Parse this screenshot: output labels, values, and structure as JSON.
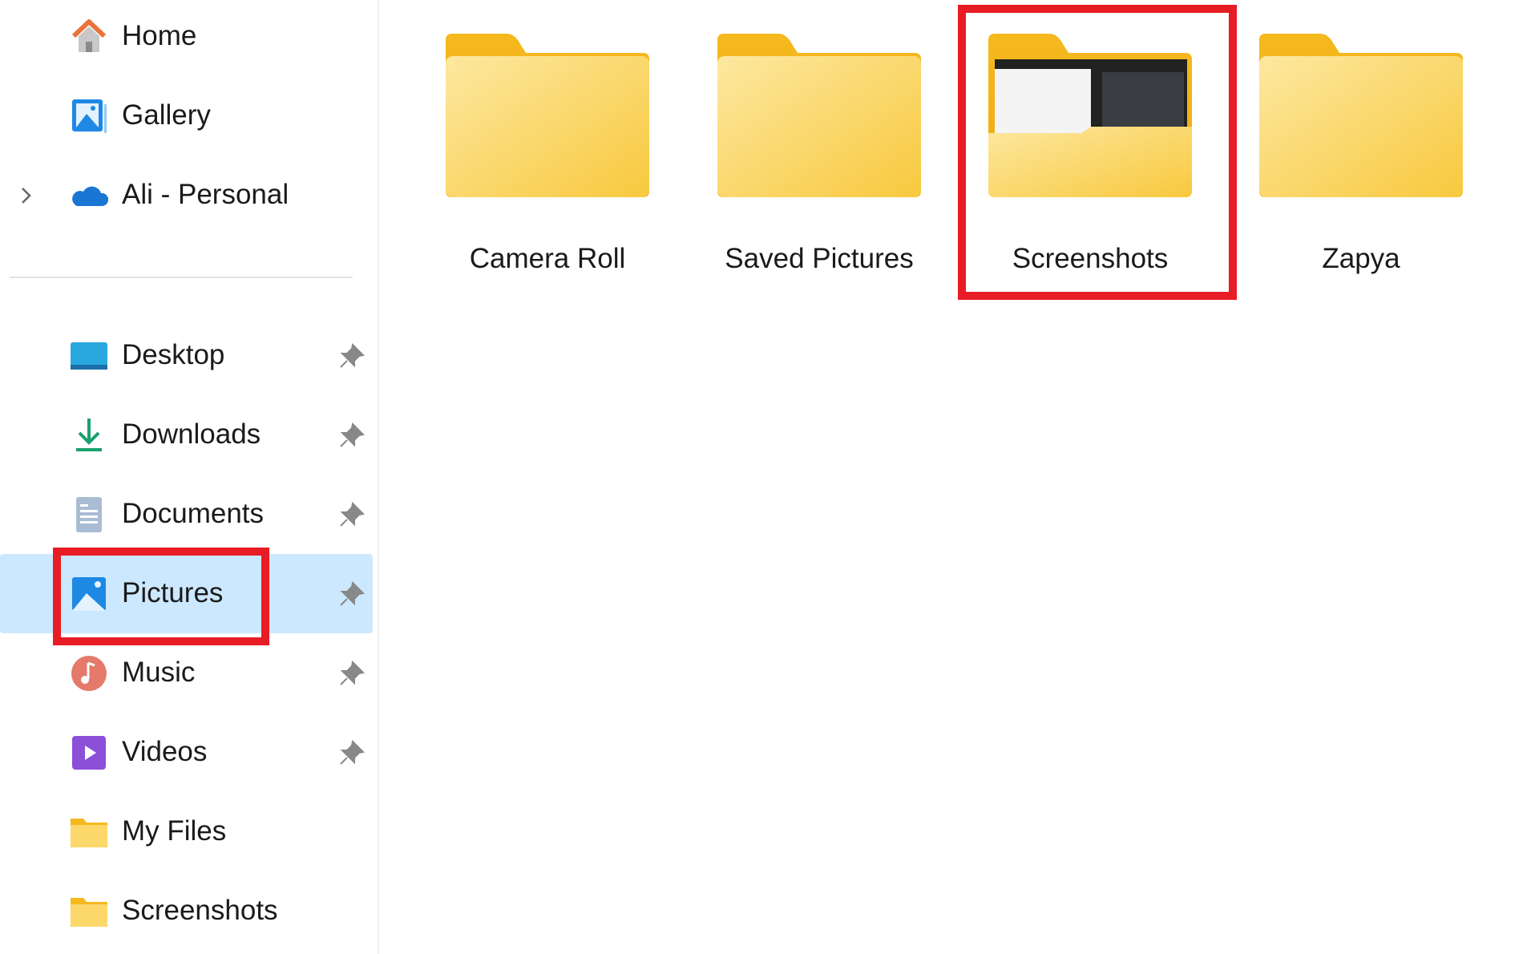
{
  "sidebar": {
    "top_items": [
      {
        "label": "Home",
        "icon": "home-icon"
      },
      {
        "label": "Gallery",
        "icon": "gallery-icon"
      },
      {
        "label": "Ali - Personal",
        "icon": "onedrive-cloud-icon",
        "expandable": true
      }
    ],
    "pinned_items": [
      {
        "label": "Desktop",
        "icon": "desktop-icon",
        "pinned": true
      },
      {
        "label": "Downloads",
        "icon": "downloads-icon",
        "pinned": true
      },
      {
        "label": "Documents",
        "icon": "documents-icon",
        "pinned": true
      },
      {
        "label": "Pictures",
        "icon": "pictures-icon",
        "pinned": true,
        "selected": true
      },
      {
        "label": "Music",
        "icon": "music-icon",
        "pinned": true
      },
      {
        "label": "Videos",
        "icon": "videos-icon",
        "pinned": true
      },
      {
        "label": "My Files",
        "icon": "folder-icon",
        "pinned": false
      },
      {
        "label": "Screenshots",
        "icon": "folder-icon",
        "pinned": false
      }
    ]
  },
  "main": {
    "folders": [
      {
        "name": "Camera Roll"
      },
      {
        "name": "Saved Pictures"
      },
      {
        "name": "Screenshots",
        "has_preview": true,
        "highlighted": true
      },
      {
        "name": "Zapya"
      }
    ]
  },
  "colors": {
    "selection": "#cce8ff",
    "highlight_box": "#e81c24",
    "folder": "#f7c948"
  }
}
